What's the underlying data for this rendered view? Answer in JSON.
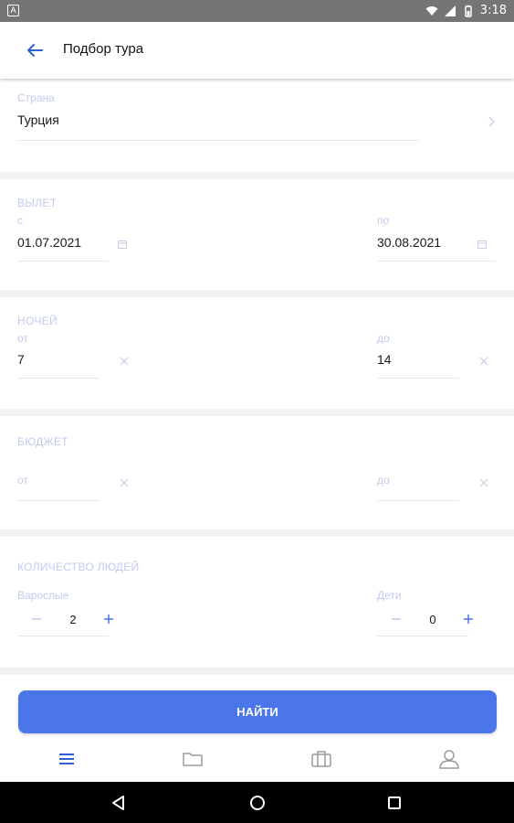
{
  "status_bar": {
    "time": "3:18",
    "left_badge": "A"
  },
  "header": {
    "title": "Подбор тура"
  },
  "country": {
    "label": "Страна",
    "value": "Турция"
  },
  "departure": {
    "section": "ВЫЛЕТ",
    "from_label": "с",
    "from_value": "01.07.2021",
    "to_label": "по",
    "to_value": "30.08.2021"
  },
  "nights": {
    "section": "НОЧЕЙ",
    "from_label": "от",
    "from_value": "7",
    "to_label": "до",
    "to_value": "14"
  },
  "budget": {
    "section": "БЮДЖЕТ",
    "from_placeholder": "от",
    "to_placeholder": "до"
  },
  "people": {
    "section": "КОЛИЧЕСТВО ЛЮДЕЙ",
    "adults_label": "Варослые",
    "adults_value": "2",
    "children_label": "Дети",
    "children_value": "0"
  },
  "actions": {
    "find_label": "НАЙТИ"
  },
  "colors": {
    "accent": "#4a76ea",
    "label": "#c3c9ee",
    "background": "#f2f2f4"
  },
  "icons": {
    "back": "arrow-left-icon",
    "chevron": "chevron-right-icon",
    "calendar": "calendar-icon",
    "clear": "close-icon",
    "minus": "minus-icon",
    "plus": "plus-icon",
    "nav": [
      "menu-icon",
      "folder-icon",
      "briefcase-icon",
      "profile-icon"
    ]
  }
}
